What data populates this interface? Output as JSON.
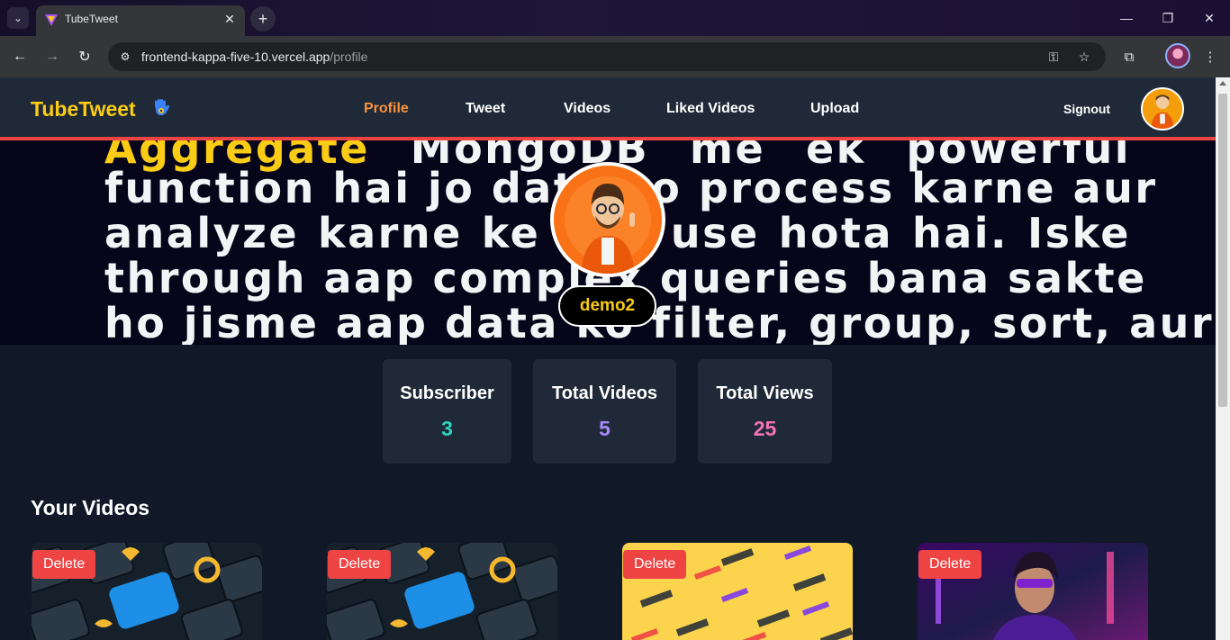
{
  "browser": {
    "tab_title": "TubeTweet",
    "url_host": "frontend-kappa-five-10.vercel.app",
    "url_path": "/profile"
  },
  "header": {
    "logo": "TubeTweet",
    "nav": [
      "Profile",
      "Tweet",
      "Videos",
      "Liked Videos",
      "Upload"
    ],
    "active_nav": "Profile",
    "signout": "Signout"
  },
  "cover": {
    "lines": [
      {
        "highlight": "Aggregate",
        "rest": " MongoDB me ek powerful"
      },
      {
        "highlight": "",
        "rest": "function hai jo data ko process karne aur"
      },
      {
        "highlight": "",
        "rest": "analyze karne ke liye use hota hai. Iske"
      },
      {
        "highlight": "",
        "rest": "through aap complex queries bana sakte"
      },
      {
        "highlight": "",
        "rest": "ho jisme aap data ko filter, group, sort, aur"
      }
    ]
  },
  "profile": {
    "username": "demo2"
  },
  "stats": [
    {
      "label": "Subscriber",
      "value": "3",
      "color": "#2dd4bf"
    },
    {
      "label": "Total Videos",
      "value": "5",
      "color": "#a78bfa"
    },
    {
      "label": "Total Views",
      "value": "25",
      "color": "#f472b6"
    }
  ],
  "videos_section": {
    "title": "Your Videos",
    "delete_label": "Delete",
    "videos": [
      {
        "thumbnail": "amazon-ajio-keyboard"
      },
      {
        "thumbnail": "amazon-ajio-keyboard"
      },
      {
        "thumbnail": "build-resume-pattern"
      },
      {
        "thumbnail": "neon-portrait"
      }
    ]
  },
  "colors": {
    "accent": "#fb923c",
    "logo": "#facc15",
    "header_border": "#ef4444",
    "delete": "#ef4444"
  }
}
